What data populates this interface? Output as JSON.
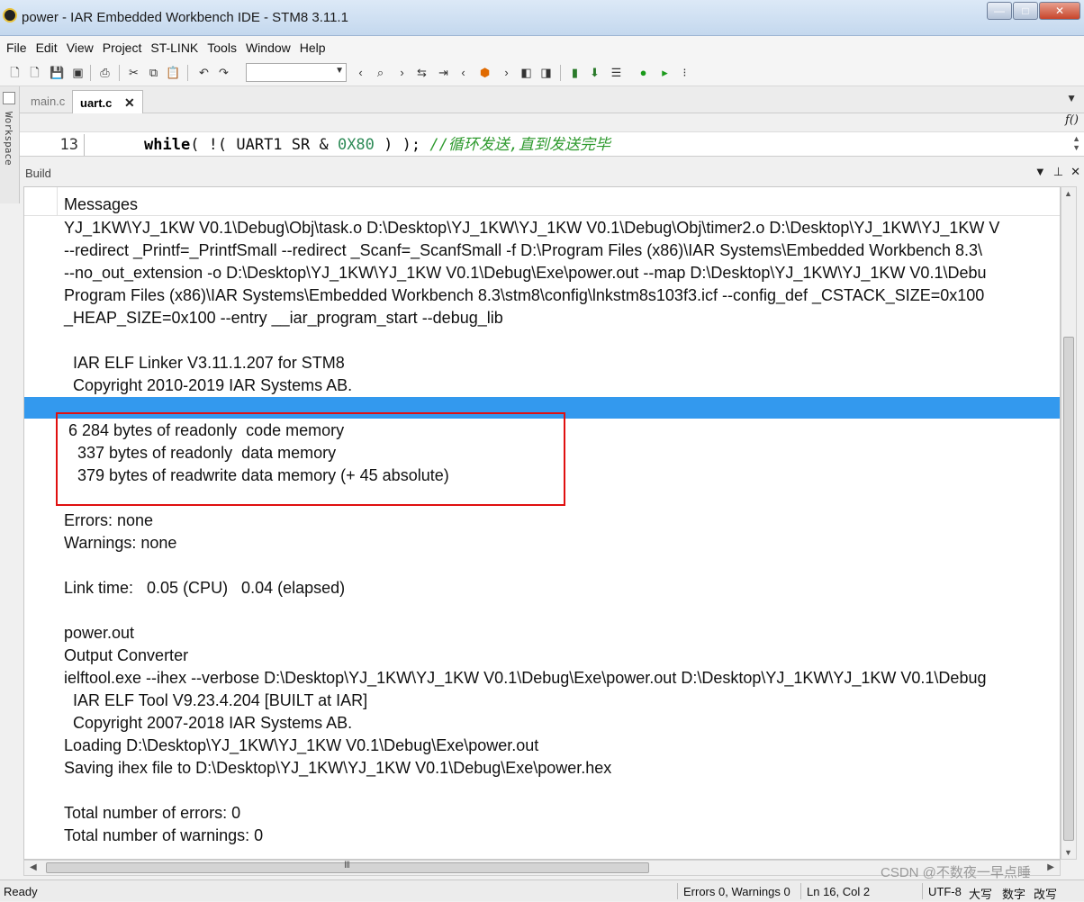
{
  "window": {
    "title": "power - IAR Embedded Workbench IDE - STM8 3.11.1",
    "buttons": {
      "minimize": "—",
      "maximize": "□",
      "close": "✕"
    }
  },
  "menu": [
    "File",
    "Edit",
    "View",
    "Project",
    "ST-LINK",
    "Tools",
    "Window",
    "Help"
  ],
  "workspace_label": "Workspace",
  "tabs": [
    {
      "label": "main.c",
      "active": false
    },
    {
      "label": "uart.c",
      "active": true,
      "close": "✕"
    }
  ],
  "editor": {
    "function_label": "f()",
    "line_number": "13",
    "code": {
      "keyword": "while",
      "part1": "( !( UART1 SR & ",
      "number": "0X80",
      "part2": " ) ); ",
      "comment": "//循环发送,直到发送完毕"
    }
  },
  "build": {
    "title": "Build",
    "column_header": "Messages",
    "lines": [
      "YJ_1KW\\YJ_1KW V0.1\\Debug\\Obj\\task.o D:\\Desktop\\YJ_1KW\\YJ_1KW V0.1\\Debug\\Obj\\timer2.o D:\\Desktop\\YJ_1KW\\YJ_1KW V",
      "--redirect _Printf=_PrintfSmall --redirect _Scanf=_ScanfSmall -f D:\\Program Files (x86)\\IAR Systems\\Embedded Workbench 8.3\\",
      "--no_out_extension -o D:\\Desktop\\YJ_1KW\\YJ_1KW V0.1\\Debug\\Exe\\power.out --map D:\\Desktop\\YJ_1KW\\YJ_1KW V0.1\\Debu",
      "Program Files (x86)\\IAR Systems\\Embedded Workbench 8.3\\stm8\\config\\lnkstm8s103f3.icf --config_def _CSTACK_SIZE=0x100",
      "_HEAP_SIZE=0x100 --entry __iar_program_start --debug_lib",
      "",
      "  IAR ELF Linker V3.11.1.207 for STM8",
      "  Copyright 2010-2019 IAR Systems AB.",
      "",
      " 6 284 bytes of readonly  code memory",
      "   337 bytes of readonly  data memory",
      "   379 bytes of readwrite data memory (+ 45 absolute)",
      "",
      "Errors: none",
      "Warnings: none",
      "",
      "Link time:   0.05 (CPU)   0.04 (elapsed)",
      "",
      "power.out",
      "Output Converter",
      "ielftool.exe --ihex --verbose D:\\Desktop\\YJ_1KW\\YJ_1KW V0.1\\Debug\\Exe\\power.out D:\\Desktop\\YJ_1KW\\YJ_1KW V0.1\\Debug",
      "  IAR ELF Tool V9.23.4.204 [BUILT at IAR]",
      "  Copyright 2007-2018 IAR Systems AB.",
      "Loading D:\\Desktop\\YJ_1KW\\YJ_1KW V0.1\\Debug\\Exe\\power.out",
      "Saving ihex file to D:\\Desktop\\YJ_1KW\\YJ_1KW V0.1\\Debug\\Exe\\power.hex",
      "",
      "Total number of errors: 0",
      "Total number of warnings: 0"
    ]
  },
  "status": {
    "ready": "Ready",
    "errors_warnings": "Errors 0, Warnings 0",
    "position": "Ln 16, Col 2",
    "encoding": "UTF-8",
    "mode1": "大写",
    "mode2": "数字",
    "mode3": "改写",
    "watermark": "CSDN @不数夜一早点睡"
  },
  "colors": {
    "selection": "#3399ee",
    "annotation_box": "#e01010",
    "comment": "#2e9a2e",
    "number": "#2e8b57"
  }
}
